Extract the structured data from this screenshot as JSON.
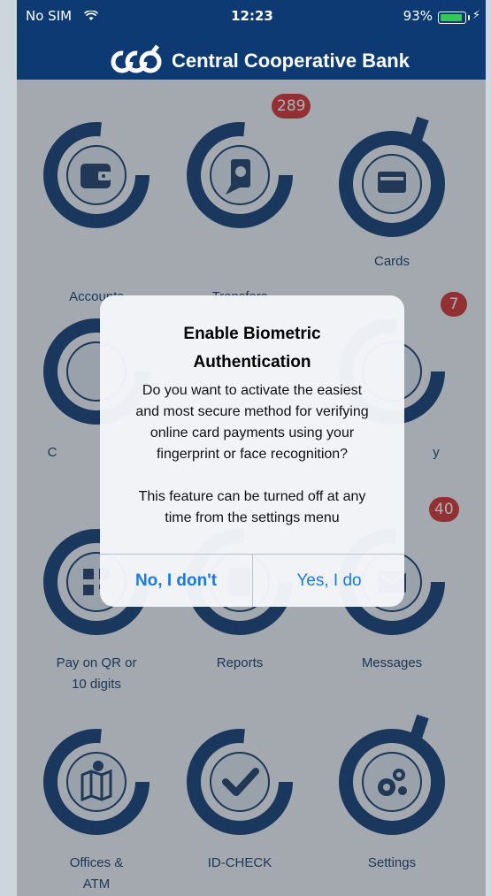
{
  "status_bar": {
    "carrier": "No SIM",
    "time": "12:23",
    "battery": "93%"
  },
  "header": {
    "bank_name": "Central Cooperative Bank"
  },
  "tiles": [
    {
      "label": "Accounts",
      "icon": "wallet-icon"
    },
    {
      "label": "Transfers",
      "icon": "money-transfer-icon",
      "badge": "289"
    },
    {
      "label": "Cards",
      "icon": "card-icon"
    },
    {
      "label": "C",
      "icon": "hidden-icon"
    },
    {
      "label": "",
      "icon": "hidden-icon"
    },
    {
      "label": "y",
      "icon": "hidden-icon",
      "badge": "7"
    },
    {
      "label": "Pay on QR or\n10 digits",
      "label_lines": [
        "Pay on QR or",
        "10 digits"
      ],
      "icon": "qr-code-icon"
    },
    {
      "label": "Reports",
      "icon": "reports-icon"
    },
    {
      "label": "Messages",
      "icon": "envelope-icon",
      "badge": "40"
    },
    {
      "label_lines": [
        "Offices &",
        "ATM"
      ],
      "icon": "map-icon"
    },
    {
      "label": "ID-CHECK",
      "icon": "checkmark-icon"
    },
    {
      "label": "Settings",
      "icon": "gears-icon"
    }
  ],
  "dialog": {
    "title_line1": "Enable Biometric",
    "title_line2": "Authentication",
    "message_lines": [
      "Do you want to activate the easiest",
      "and most secure method for verifying",
      "online card payments using your",
      "fingerprint or face recognition?"
    ],
    "note_lines": [
      "This feature can be turned off at any",
      "time from the settings menu"
    ],
    "cancel_label": "No, I don't",
    "confirm_label": "Yes, I do"
  },
  "colors": {
    "header": "#0d3a72",
    "accent": "#1a7ae0",
    "badge": "#d62f2f",
    "ring": "#123d73"
  }
}
